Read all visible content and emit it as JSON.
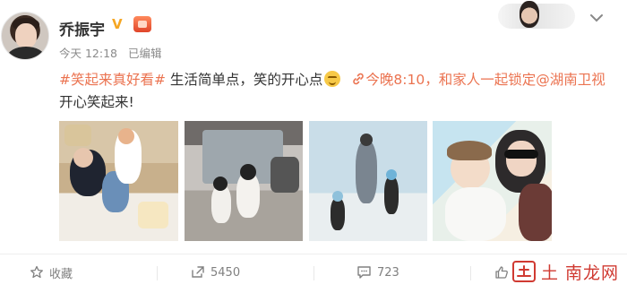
{
  "post": {
    "username": "乔振宇",
    "verified_badge": "V",
    "time": "今天 12:18",
    "edited": "已编辑",
    "text": {
      "hashtag": "#笑起来真好看#",
      "line1": " 生活简单点，笑的开心点",
      "link_label": "今晚8:10，和家人一起锁定@湖南卫视",
      "line2": "开心笑起来!"
    },
    "images": [
      {
        "icon": "family-living-room-photo"
      },
      {
        "icon": "kids-hallway-photo"
      },
      {
        "icon": "watercolor-family-walk-painting"
      },
      {
        "icon": "watercolor-mother-child-painting"
      }
    ]
  },
  "actions": {
    "favorite_label": "收藏",
    "repost_count": "5450",
    "comment_count": "723",
    "like_label": ""
  },
  "watermark": {
    "text": "土 南龙网"
  },
  "colors": {
    "accent": "#eb7350",
    "muted": "#808080",
    "verified": "#f5a623"
  }
}
